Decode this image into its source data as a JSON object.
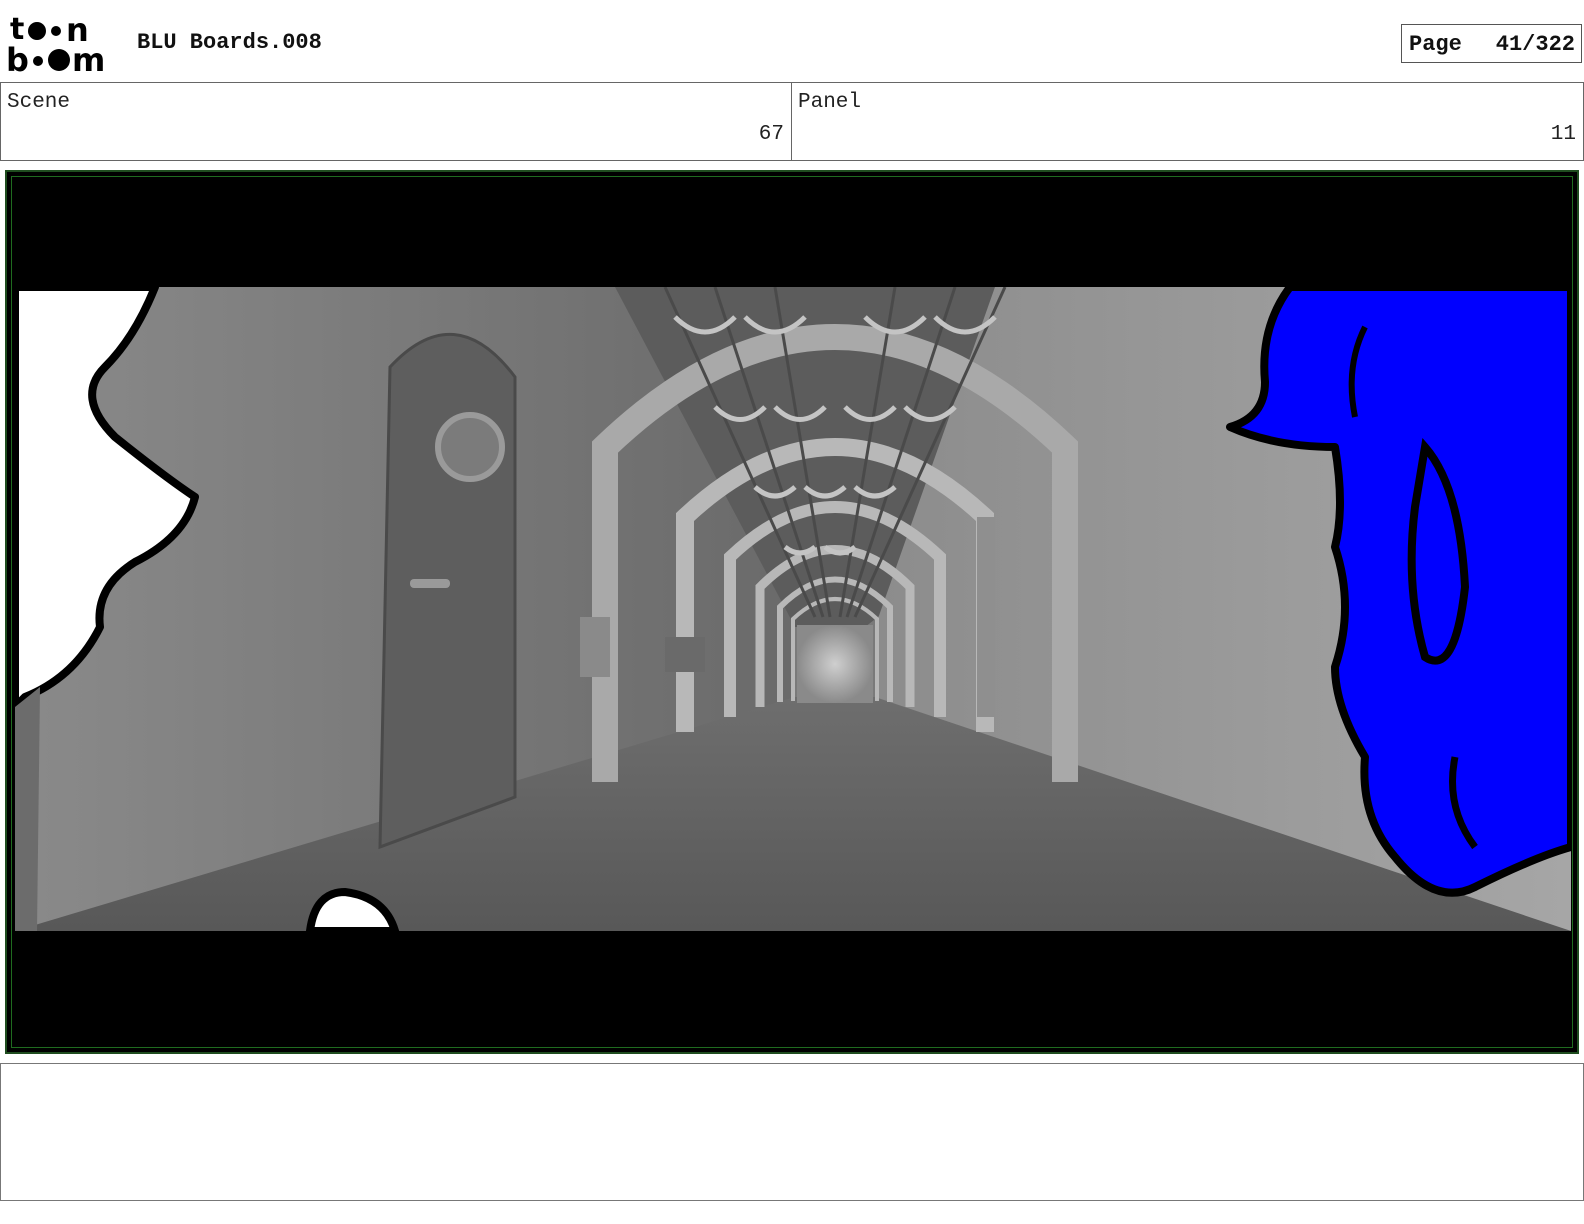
{
  "header": {
    "logo_text": "toonboom",
    "title": "BLU Boards.008",
    "page_label": "Page",
    "page_number": "41/322"
  },
  "scene": {
    "label": "Scene",
    "value": "67"
  },
  "panel": {
    "label": "Panel",
    "value": "11"
  },
  "colors": {
    "character_blue": "#0000ff",
    "frame_border": "#1f4d1f"
  }
}
